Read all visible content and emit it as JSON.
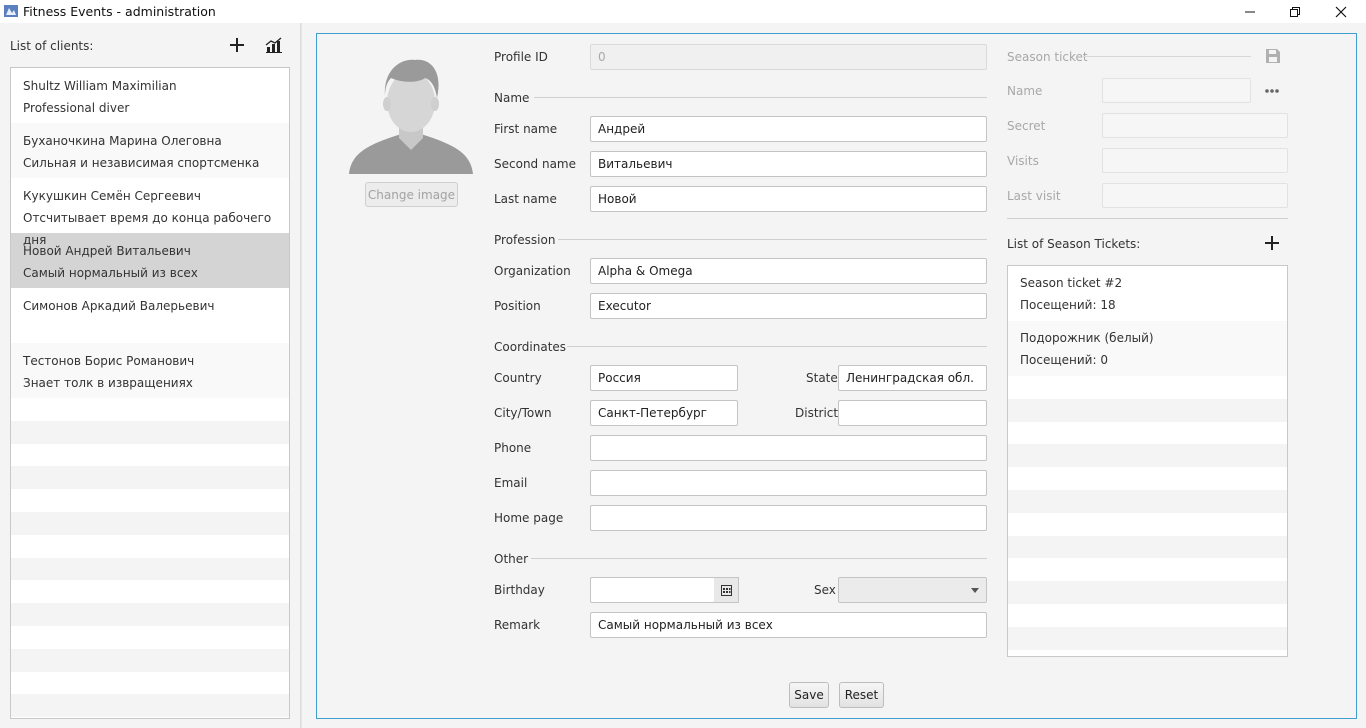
{
  "window": {
    "title": "Fitness Events - administration"
  },
  "sidebar": {
    "title": "List of clients:",
    "clients": [
      {
        "name": "Shultz William Maximilian",
        "note": "Professional diver"
      },
      {
        "name": "Буханочкина Марина Олеговна",
        "note": "Сильная и независимая спортсменка"
      },
      {
        "name": "Кукушкин Семён Сергеевич",
        "note": "Отсчитывает время до конца рабочего дня"
      },
      {
        "name": "Новой Андрей Витальевич",
        "note": "Самый нормальный из всех"
      },
      {
        "name": "Симонов Аркадий Валерьевич",
        "note": ""
      },
      {
        "name": "Тестонов Борис Романович",
        "note": "Знает толк в извращениях"
      }
    ]
  },
  "profile": {
    "change_image_label": "Change image",
    "profile_id_label": "Profile ID",
    "profile_id_value": "0",
    "name_section": "Name",
    "first_name_label": "First name",
    "first_name_value": "Андрей",
    "second_name_label": "Second name",
    "second_name_value": "Витальевич",
    "last_name_label": "Last name",
    "last_name_value": "Новой",
    "profession_section": "Profession",
    "organization_label": "Organization",
    "organization_value": "Alpha & Omega",
    "position_label": "Position",
    "position_value": "Executor",
    "coordinates_section": "Coordinates",
    "country_label": "Country",
    "country_value": "Россия",
    "state_label": "State",
    "state_value": "Ленинградская обл.",
    "city_label": "City/Town",
    "city_value": "Санкт-Петербург",
    "district_label": "District",
    "district_value": "",
    "phone_label": "Phone",
    "phone_value": "",
    "email_label": "Email",
    "email_value": "",
    "homepage_label": "Home page",
    "homepage_value": "",
    "other_section": "Other",
    "birthday_label": "Birthday",
    "birthday_value": "",
    "sex_label": "Sex",
    "sex_value": "",
    "remark_label": "Remark",
    "remark_value": "Самый нормальный из всех"
  },
  "season_ticket": {
    "section": "Season ticket",
    "name_label": "Name",
    "secret_label": "Secret",
    "visits_label": "Visits",
    "last_visit_label": "Last visit",
    "list_title": "List of Season Tickets:",
    "tickets": [
      {
        "name": "Season ticket #2",
        "visits": "Посещений: 18"
      },
      {
        "name": "Подорожник (белый)",
        "visits": "Посещений: 0"
      }
    ]
  },
  "actions": {
    "save_label": "Save",
    "reset_label": "Reset"
  },
  "icons": {
    "app": "app-icon",
    "add_client": "plus-icon",
    "stats": "chart-icon",
    "save_ticket": "floppy-disk-icon",
    "more": "ellipsis-icon",
    "add_ticket": "plus-icon",
    "calendar": "calendar-icon"
  },
  "colors": {
    "accent_border": "#3fa0d0",
    "selected_row": "#d4d4d4"
  }
}
